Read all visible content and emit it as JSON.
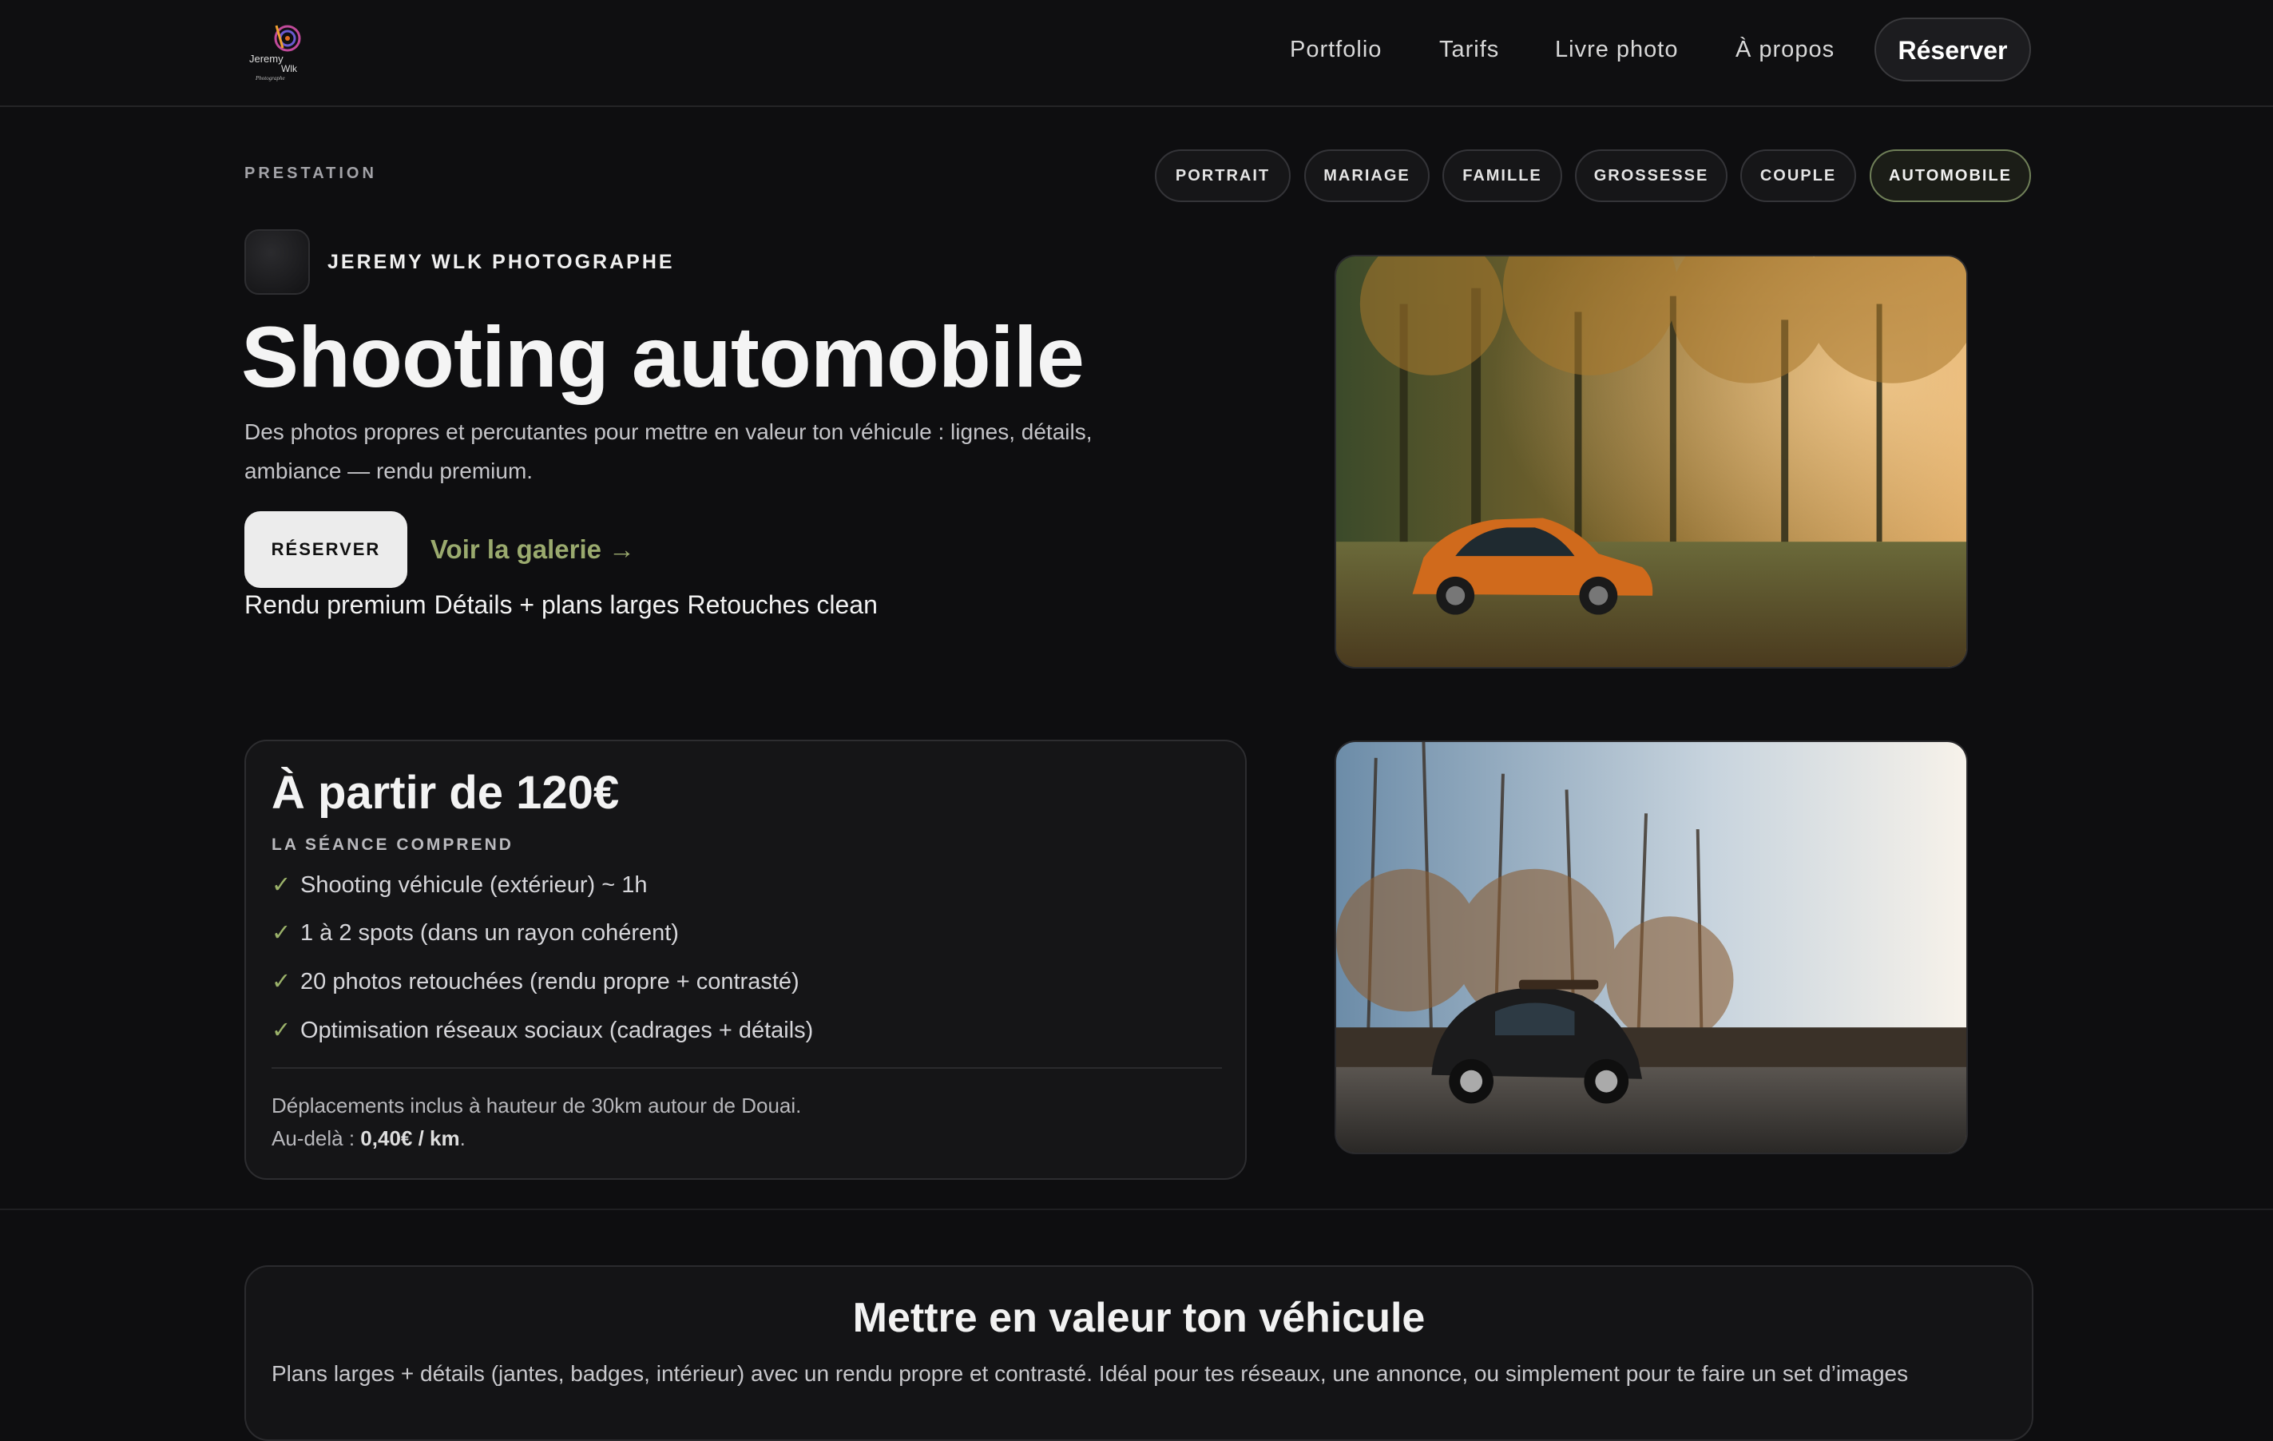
{
  "header": {
    "logo": {
      "line1": "Jeremy",
      "line2": "Wlk",
      "line3": "Photographe"
    },
    "nav": [
      "Portfolio",
      "Tarifs",
      "Livre photo",
      "À propos"
    ],
    "cta": "Réserver"
  },
  "hero": {
    "eyebrow": "PRESTATION",
    "categories": [
      "PORTRAIT",
      "MARIAGE",
      "FAMILLE",
      "GROSSESSE",
      "COUPLE",
      "AUTOMOBILE"
    ],
    "active_category": "AUTOMOBILE",
    "brand": "JEREMY WLK PHOTOGRAPHE",
    "title": "Shooting automobile",
    "subtitle": "Des photos propres et percutantes pour mettre en valeur ton véhicule : lignes, détails, ambiance — rendu premium.",
    "primary_button": "RÉSERVER",
    "secondary_link": "Voir la galerie →",
    "tags": [
      "Rendu premium",
      "Détails + plans larges",
      "Retouches clean"
    ]
  },
  "pricing": {
    "title": "À partir de 120€",
    "includes_label": "LA SÉANCE COMPREND",
    "features": [
      "Shooting véhicule (extérieur) ~ 1h",
      "1 à 2 spots (dans un rayon cohérent)",
      "20 photos retouchées (rendu propre + contrasté)",
      "Optimisation réseaux sociaux (cadrages + détails)"
    ],
    "travel_note": "Déplacements inclus à hauteur de 30km autour de Douai.",
    "extra_prefix": "Au-delà : ",
    "extra_price": "0,40€ / km",
    "extra_suffix": "."
  },
  "section": {
    "title": "Mettre en valeur ton véhicule",
    "text": "Plans larges + détails (jantes, badges, intérieur) avec un rendu propre et contrasté. Idéal pour tes réseaux, une annonce, ou simplement pour te faire un set d’images"
  },
  "colors": {
    "background": "#0e0e10",
    "accent_green": "#9aaa6e",
    "card": "#151517",
    "check": "#9bb26a"
  },
  "icons": {
    "check": "check-icon",
    "arrow": "arrow-right-icon"
  }
}
